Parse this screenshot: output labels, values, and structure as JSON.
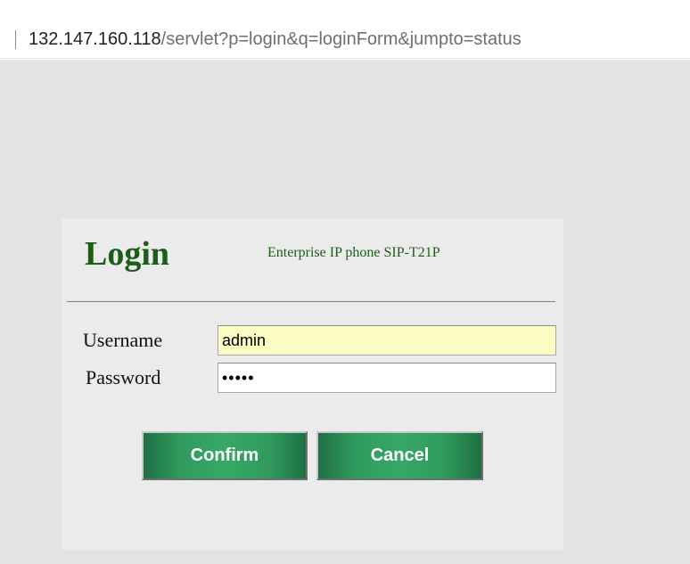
{
  "browser": {
    "address_host": "132.147.160.118",
    "address_path": "/servlet?p=login&q=loginForm&jumpto=status"
  },
  "login": {
    "title": "Login",
    "subtitle": "Enterprise IP phone SIP-T21P",
    "username_label": "Username",
    "username_value": "admin",
    "password_label": "Password",
    "password_value": "•••••",
    "confirm_label": "Confirm",
    "cancel_label": "Cancel"
  },
  "colors": {
    "title_green": "#1c5e18",
    "button_green": "#2f9a5d",
    "username_field_bg": "#fafcc4",
    "page_background": "#e4e4e4",
    "panel_background": "#ebebeb"
  }
}
